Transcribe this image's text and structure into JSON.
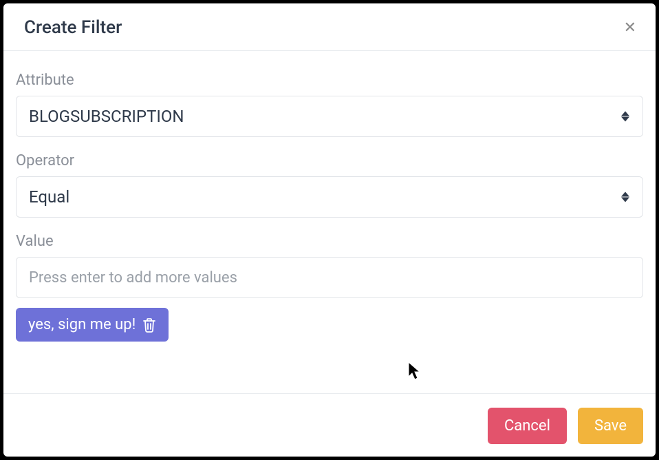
{
  "modal": {
    "title": "Create Filter"
  },
  "form": {
    "attribute": {
      "label": "Attribute",
      "value": "BLOGSUBSCRIPTION"
    },
    "operator": {
      "label": "Operator",
      "value": "Equal"
    },
    "value": {
      "label": "Value",
      "placeholder": "Press enter to add more values"
    },
    "chip": {
      "label": "yes, sign me up!"
    }
  },
  "footer": {
    "cancel": "Cancel",
    "save": "Save"
  }
}
